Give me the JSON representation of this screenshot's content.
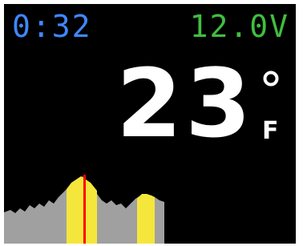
{
  "status": {
    "timer": "0:32",
    "voltage": "12.0V"
  },
  "temperature": {
    "value": "23",
    "unit": "F",
    "degree_symbol": "degree-circle-icon"
  },
  "colors": {
    "background": "#000000",
    "timer": "#3f88ff",
    "voltage": "#3fbf3f",
    "temperature": "#ffffff",
    "spectrum_fill": "#a0a0a0",
    "highlight_band": "#f5e63c",
    "marker_line": "#ff0000"
  },
  "spectrum": {
    "description_icon": "signal-spectrum-graph"
  }
}
